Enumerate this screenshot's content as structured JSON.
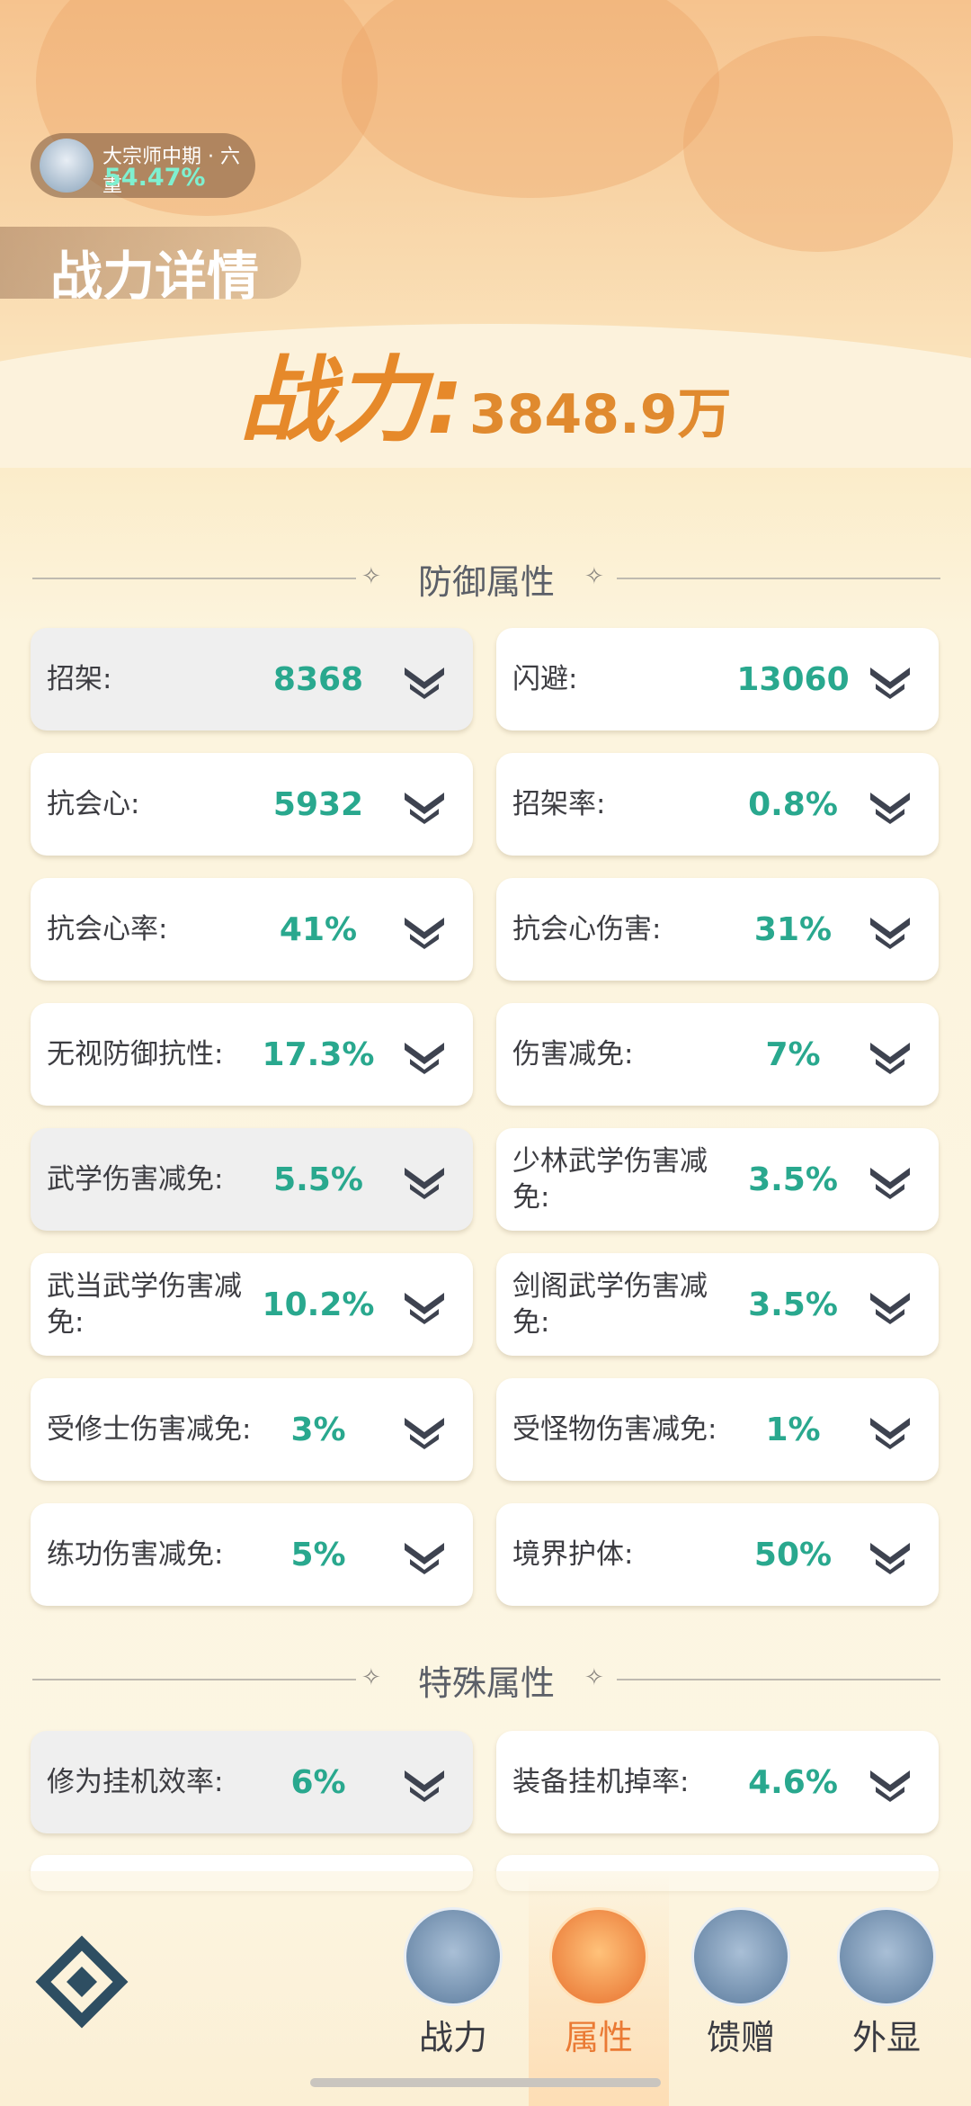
{
  "realm": {
    "name": "大宗师中期 · 六重",
    "progress": "54.47%"
  },
  "header": {
    "title": "战力详情"
  },
  "power": {
    "label": "战力:",
    "value": "3848.9万"
  },
  "defense_section": {
    "title": "防御属性",
    "items": [
      {
        "label": "招架:",
        "value": "8368"
      },
      {
        "label": "闪避:",
        "value": "13060"
      },
      {
        "label": "抗会心:",
        "value": "5932"
      },
      {
        "label": "招架率:",
        "value": "0.8%"
      },
      {
        "label": "抗会心率:",
        "value": "41%"
      },
      {
        "label": "抗会心伤害:",
        "value": "31%"
      },
      {
        "label": "无视防御抗性:",
        "value": "17.3%"
      },
      {
        "label": "伤害减免:",
        "value": "7%"
      },
      {
        "label": "武学伤害减免:",
        "value": "5.5%"
      },
      {
        "label": "少林武学伤害减免:",
        "value": "3.5%"
      },
      {
        "label": "武当武学伤害减免:",
        "value": "10.2%"
      },
      {
        "label": "剑阁武学伤害减免:",
        "value": "3.5%"
      },
      {
        "label": "受修士伤害减免:",
        "value": "3%"
      },
      {
        "label": "受怪物伤害减免:",
        "value": "1%"
      },
      {
        "label": "练功伤害减免:",
        "value": "5%"
      },
      {
        "label": "境界护体:",
        "value": "50%"
      }
    ]
  },
  "special_section": {
    "title": "特殊属性",
    "items": [
      {
        "label": "修为挂机效率:",
        "value": "6%"
      },
      {
        "label": "装备挂机掉率:",
        "value": "4.6%"
      }
    ]
  },
  "nav": {
    "tabs": [
      {
        "label": "战力",
        "icon": "swords-icon"
      },
      {
        "label": "属性",
        "icon": "shield-icon"
      },
      {
        "label": "馈赠",
        "icon": "gift-icon"
      },
      {
        "label": "外显",
        "icon": "castle-icon"
      }
    ],
    "active": "属性"
  }
}
